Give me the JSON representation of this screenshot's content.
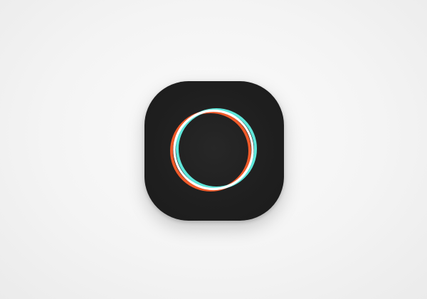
{
  "icon": {
    "name": "polarr-app-icon",
    "tile_color": "#1f1f1f",
    "ring_colors": {
      "orange": "#ef5a2a",
      "cyan": "#5fe6da",
      "white": "#ffffff"
    }
  }
}
